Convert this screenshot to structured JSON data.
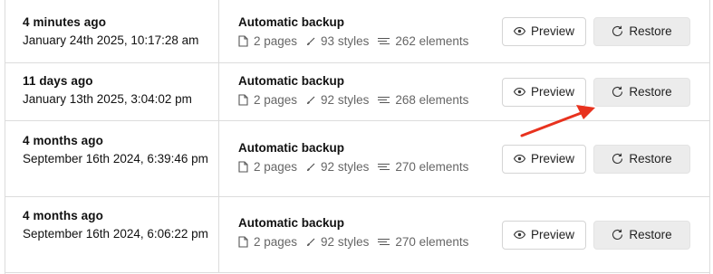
{
  "versions": [
    {
      "ago": "4 minutes ago",
      "date": "January 24th 2025, 10:17:28 am",
      "title": "Automatic backup",
      "pages": "2 pages",
      "styles": "93 styles",
      "elements": "262 elements"
    },
    {
      "ago": "11 days ago",
      "date": "January 13th 2025, 3:04:02 pm",
      "title": "Automatic backup",
      "pages": "2 pages",
      "styles": "92 styles",
      "elements": "268 elements"
    },
    {
      "ago": "4 months ago",
      "date": "September 16th 2024, 6:39:46 pm",
      "title": "Automatic backup",
      "pages": "2 pages",
      "styles": "92 styles",
      "elements": "270 elements"
    },
    {
      "ago": "4 months ago",
      "date": "September 16th 2024, 6:06:22 pm",
      "title": "Automatic backup",
      "pages": "2 pages",
      "styles": "92 styles",
      "elements": "270 elements"
    }
  ],
  "buttons": {
    "preview": "Preview",
    "restore": "Restore"
  },
  "icons": {
    "pages": "page-icon",
    "styles": "style-brush-icon",
    "elements": "elements-lines-icon",
    "preview": "eye-icon",
    "restore": "restore-arrow-icon"
  },
  "colors": {
    "annotation_arrow": "#e8321e",
    "restore_bg": "#ececec",
    "border": "#dcdcdc"
  }
}
